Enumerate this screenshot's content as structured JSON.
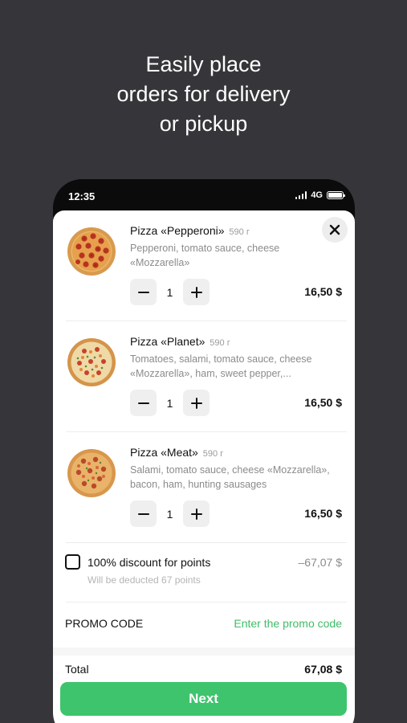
{
  "headline": {
    "line1": "Easily place",
    "line2": "orders for delivery",
    "line3": "or pickup"
  },
  "status_bar": {
    "time": "12:35",
    "network": "4G"
  },
  "cart": {
    "items": [
      {
        "name": "Pizza «Pepperoni»",
        "weight": "590 г",
        "description": "Pepperoni, tomato sauce, cheese «Mozzarella»",
        "quantity": "1",
        "price": "16,50 $"
      },
      {
        "name": "Pizza «Planet»",
        "weight": "590 г",
        "description": "Tomatoes, salami, tomato sauce, cheese «Mozzarella», ham, sweet pepper,...",
        "quantity": "1",
        "price": "16,50 $"
      },
      {
        "name": "Pizza «Meat»",
        "weight": "590 г",
        "description": "Salami, tomato sauce, cheese «Mozzarella», bacon, ham, hunting sausages",
        "quantity": "1",
        "price": "16,50 $"
      }
    ],
    "discount": {
      "label": "100% discount for points",
      "sublabel": "Will be deducted 67 points",
      "value": "–67,07 $",
      "checked": false
    },
    "promo": {
      "label": "PROMO CODE",
      "link": "Enter the promo code"
    },
    "total": {
      "label": "Total",
      "value": "67,08 $"
    },
    "next_label": "Next"
  },
  "colors": {
    "background": "#36363a",
    "accent_green": "#3ec46d",
    "promo_green": "#3ebd67"
  }
}
